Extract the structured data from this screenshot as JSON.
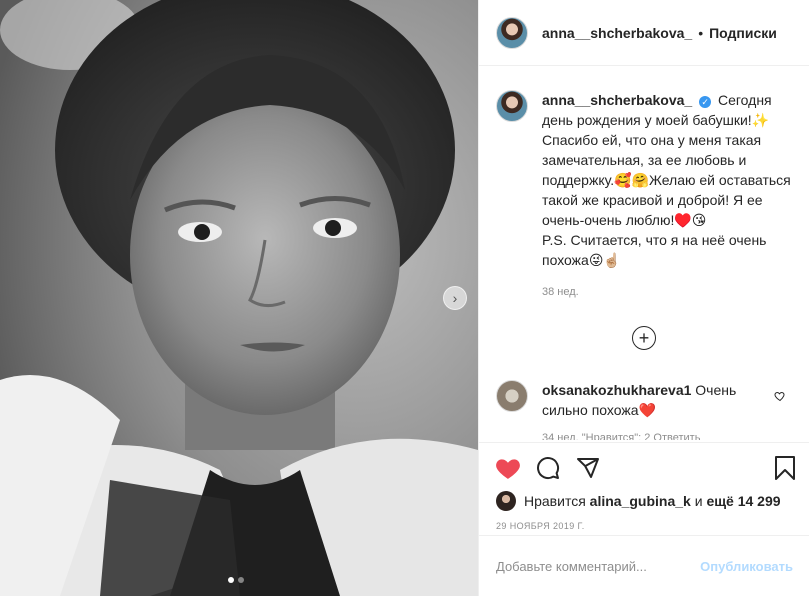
{
  "post": {
    "username": "anna__shcherbakova_",
    "follow_label": "Подписки",
    "caption_lines": [
      "Сегодня день рождения у моей бабушки!✨",
      "Спасибо ей, что она у меня такая замечательная, за ее любовь и поддержку.🥰🤗Желаю ей оставаться такой же красивой и доброй! Я ее очень-очень люблю!♥️😘",
      "P.S. Считается, что я на неё очень похожа😜☝🏼"
    ],
    "caption_time": "38 нед.",
    "more_symbol": "+"
  },
  "comment": {
    "username": "oksanakozhukhareva1",
    "text": "Очень сильно похожа❤️",
    "meta_clipped": "34 нед.   \"Нравится\": 2   Ответить"
  },
  "likes": {
    "prefix": "Нравится",
    "liked_by": "alina_gubina_k",
    "joiner": "и",
    "others": "ещё 14 299"
  },
  "date": "29 НОЯБРЯ 2019 Г.",
  "add_comment": {
    "placeholder": "Добавьте комментарий...",
    "publish_label": "Опубликовать"
  },
  "icons": {
    "like": "heart-filled-icon",
    "comment": "comment-icon",
    "share": "share-icon",
    "save": "bookmark-icon",
    "verified": "verified-badge-icon",
    "next": "chevron-right-icon"
  },
  "colors": {
    "like_red": "#ed4956",
    "verified_blue": "#3897f0",
    "publish_disabled": "#b3dbff",
    "secondary_text": "#8e8e8e"
  },
  "carousel": {
    "count": 2,
    "current": 1
  }
}
